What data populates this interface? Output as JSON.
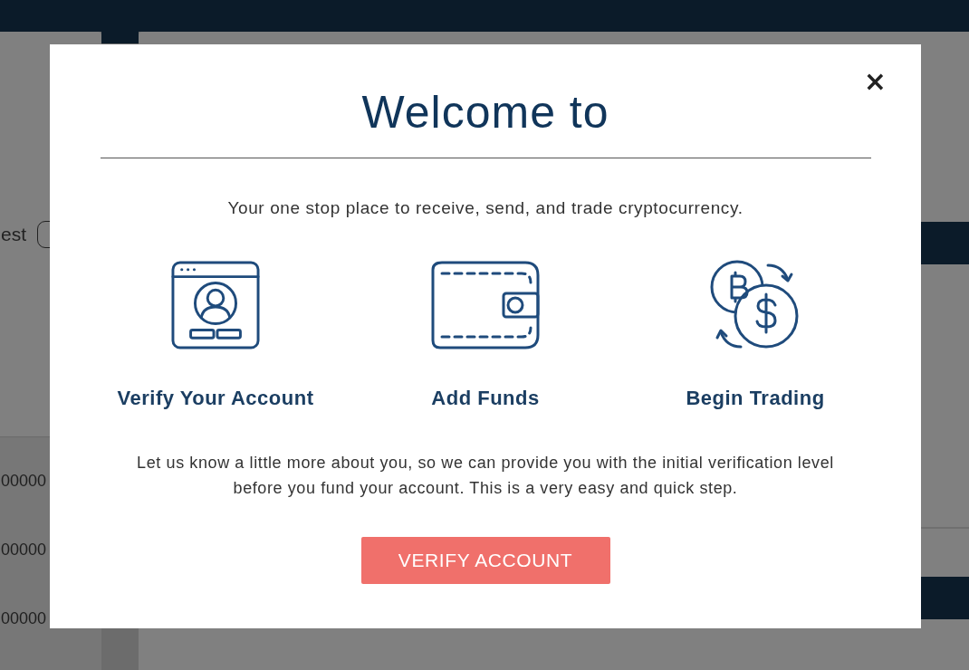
{
  "background": {
    "left_label": "est",
    "amounts": [
      "00000",
      "00000",
      "00000"
    ]
  },
  "modal": {
    "close": "×",
    "title": "Welcome to",
    "subtitle": "Your one stop place to receive, send, and trade cryptocurrency.",
    "steps": [
      {
        "kind": "verify",
        "label": "Verify Your Account"
      },
      {
        "kind": "fund",
        "label": "Add Funds"
      },
      {
        "kind": "trade",
        "label": "Begin Trading"
      }
    ],
    "description": "Let us know a little more about you, so we can provide you with the initial verification level before you fund your account. This is a very easy and quick step.",
    "button": "VERIFY ACCOUNT"
  }
}
